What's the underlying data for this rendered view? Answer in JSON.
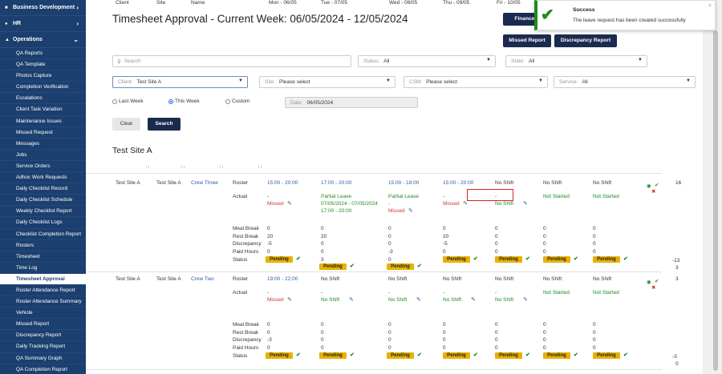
{
  "sidebar": {
    "sections": [
      {
        "label": "Business Development",
        "icon": "briefcase-icon"
      },
      {
        "label": "HR",
        "icon": "people-icon"
      },
      {
        "label": "Operations",
        "icon": "building-icon"
      }
    ],
    "items": [
      "QA Reports",
      "QA Template",
      "Photos Capture",
      "Completion Verification",
      "Escalations",
      "Client Task Variation",
      "Maintenance Issues",
      "Missed Request",
      "Messages",
      "Jobs",
      "Service Orders",
      "Adhoc Work Requests",
      "Daily Checklist Record",
      "Daily Checklist Schedule",
      "Weekly Checklist Report",
      "Daily Checklist Logs",
      "Checklist Completion Report",
      "Rosters",
      "Timesheet",
      "Time Log",
      "Timesheet Approval",
      "Roster Attendance Report",
      "Roster Attendance Summary",
      "Vehicle",
      "Missed Report",
      "Discrepancy Report",
      "Daily Tracking Report",
      "QA Summary Graph",
      "QA Completion Report"
    ],
    "active": "Timesheet Approval"
  },
  "page": {
    "title": "Timesheet Approval - Current Week: 06/05/2024 - 12/05/2024"
  },
  "toolbar": {
    "finance": "Finance E",
    "missed": "Missed Report",
    "discrepancy": "Discrepancy Report"
  },
  "toast": {
    "title": "Success",
    "message": "The leave request has been created successfully",
    "close": "×",
    "icon": "check-icon"
  },
  "filters": {
    "search_placeholder": "Search",
    "status_label": "Status:",
    "status_value": "All",
    "state_label": "State:",
    "state_value": "All",
    "client_label": "Client:",
    "client_value": "Test Site A",
    "site_label": "Site:",
    "site_value": "Please select",
    "csm_label": "CSM:",
    "csm_value": "Please select",
    "service_label": "Service:",
    "service_value": "All",
    "radios": [
      "Last Week",
      "This Week",
      "Custom"
    ],
    "radio_selected": "This Week",
    "date_label": "Date:",
    "date_value": "06/05/2024",
    "clear": "Clear",
    "search": "Search"
  },
  "site_heading": "Test Site A",
  "table": {
    "headers": {
      "client": "Client",
      "site": "Site",
      "name": "Name",
      "mon": "Mon - 06/05",
      "tue": "Tue - 07/05",
      "wed": "Wed - 08/05",
      "thu": "Thu - 09/05",
      "fri": "Fri - 10/05",
      "sat": "Sat - 11/05",
      "sun": "Sun - 12/05",
      "action": "Action",
      "total": "Total"
    },
    "labels": {
      "roster": "Roster",
      "actual": "Actual",
      "meal": "Meal Break",
      "rest": "Rest Break",
      "disc": "Discrepancy",
      "paid": "Paid Hours",
      "status": "Status"
    },
    "pending": "Pending",
    "rows": [
      {
        "client": "Test Site A",
        "site": "Test Site A",
        "name": "Crew Three",
        "roster": [
          "15:00 - 20:00",
          "17:00 - 20:00",
          "15:00 - 18:00",
          "15:00 - 20:00",
          "No Shift",
          "No Shift",
          "No Shift"
        ],
        "actual_top": [
          "-",
          "Partial Leave",
          "Partial Leave",
          "-",
          "-",
          "Not Started",
          "Not Started"
        ],
        "actual_sub": [
          "Missed",
          "07/05/2024 - 07/05/2024",
          "-",
          "Missed",
          "No Shift",
          "",
          ""
        ],
        "actual_sub2": [
          "",
          "17:00 - 20:00",
          "Missed",
          "",
          "",
          "",
          ""
        ],
        "meal": [
          "0",
          "0",
          "0",
          "0",
          "0",
          "0",
          "0"
        ],
        "rest": [
          "20",
          "20",
          "0",
          "20",
          "0",
          "0",
          "0"
        ],
        "disc": [
          "-5",
          "0",
          "0",
          "-5",
          "0",
          "0",
          "0"
        ],
        "paid": [
          "0",
          "0",
          "-3",
          "0",
          "0",
          "0",
          "0"
        ],
        "status_extra": [
          "",
          "3",
          "0",
          "",
          "",
          "",
          ""
        ],
        "total": "16",
        "total2": "-13",
        "total3": "3"
      },
      {
        "client": "Test Site A",
        "site": "Test Site A",
        "name": "Crew Two",
        "roster": [
          "19:00 - 22:00",
          "No Shift",
          "No Shift",
          "No Shift",
          "No Shift",
          "No Shift",
          "No Shift"
        ],
        "actual_top": [
          "-",
          "-",
          "-",
          "-",
          "-",
          "Not Started",
          "Not Started"
        ],
        "actual_sub": [
          "Missed",
          "No Shift",
          "No Shift",
          "No Shift",
          "No Shift",
          "",
          ""
        ],
        "meal": [
          "0",
          "0",
          "0",
          "0",
          "0",
          "0",
          "0"
        ],
        "rest": [
          "0",
          "0",
          "0",
          "0",
          "0",
          "0",
          "0"
        ],
        "disc": [
          "-3",
          "0",
          "0",
          "0",
          "0",
          "0",
          "0"
        ],
        "paid": [
          "0",
          "0",
          "0",
          "0",
          "0",
          "0",
          "0"
        ],
        "total": "3",
        "total2": "-3",
        "total3": "0"
      }
    ]
  }
}
